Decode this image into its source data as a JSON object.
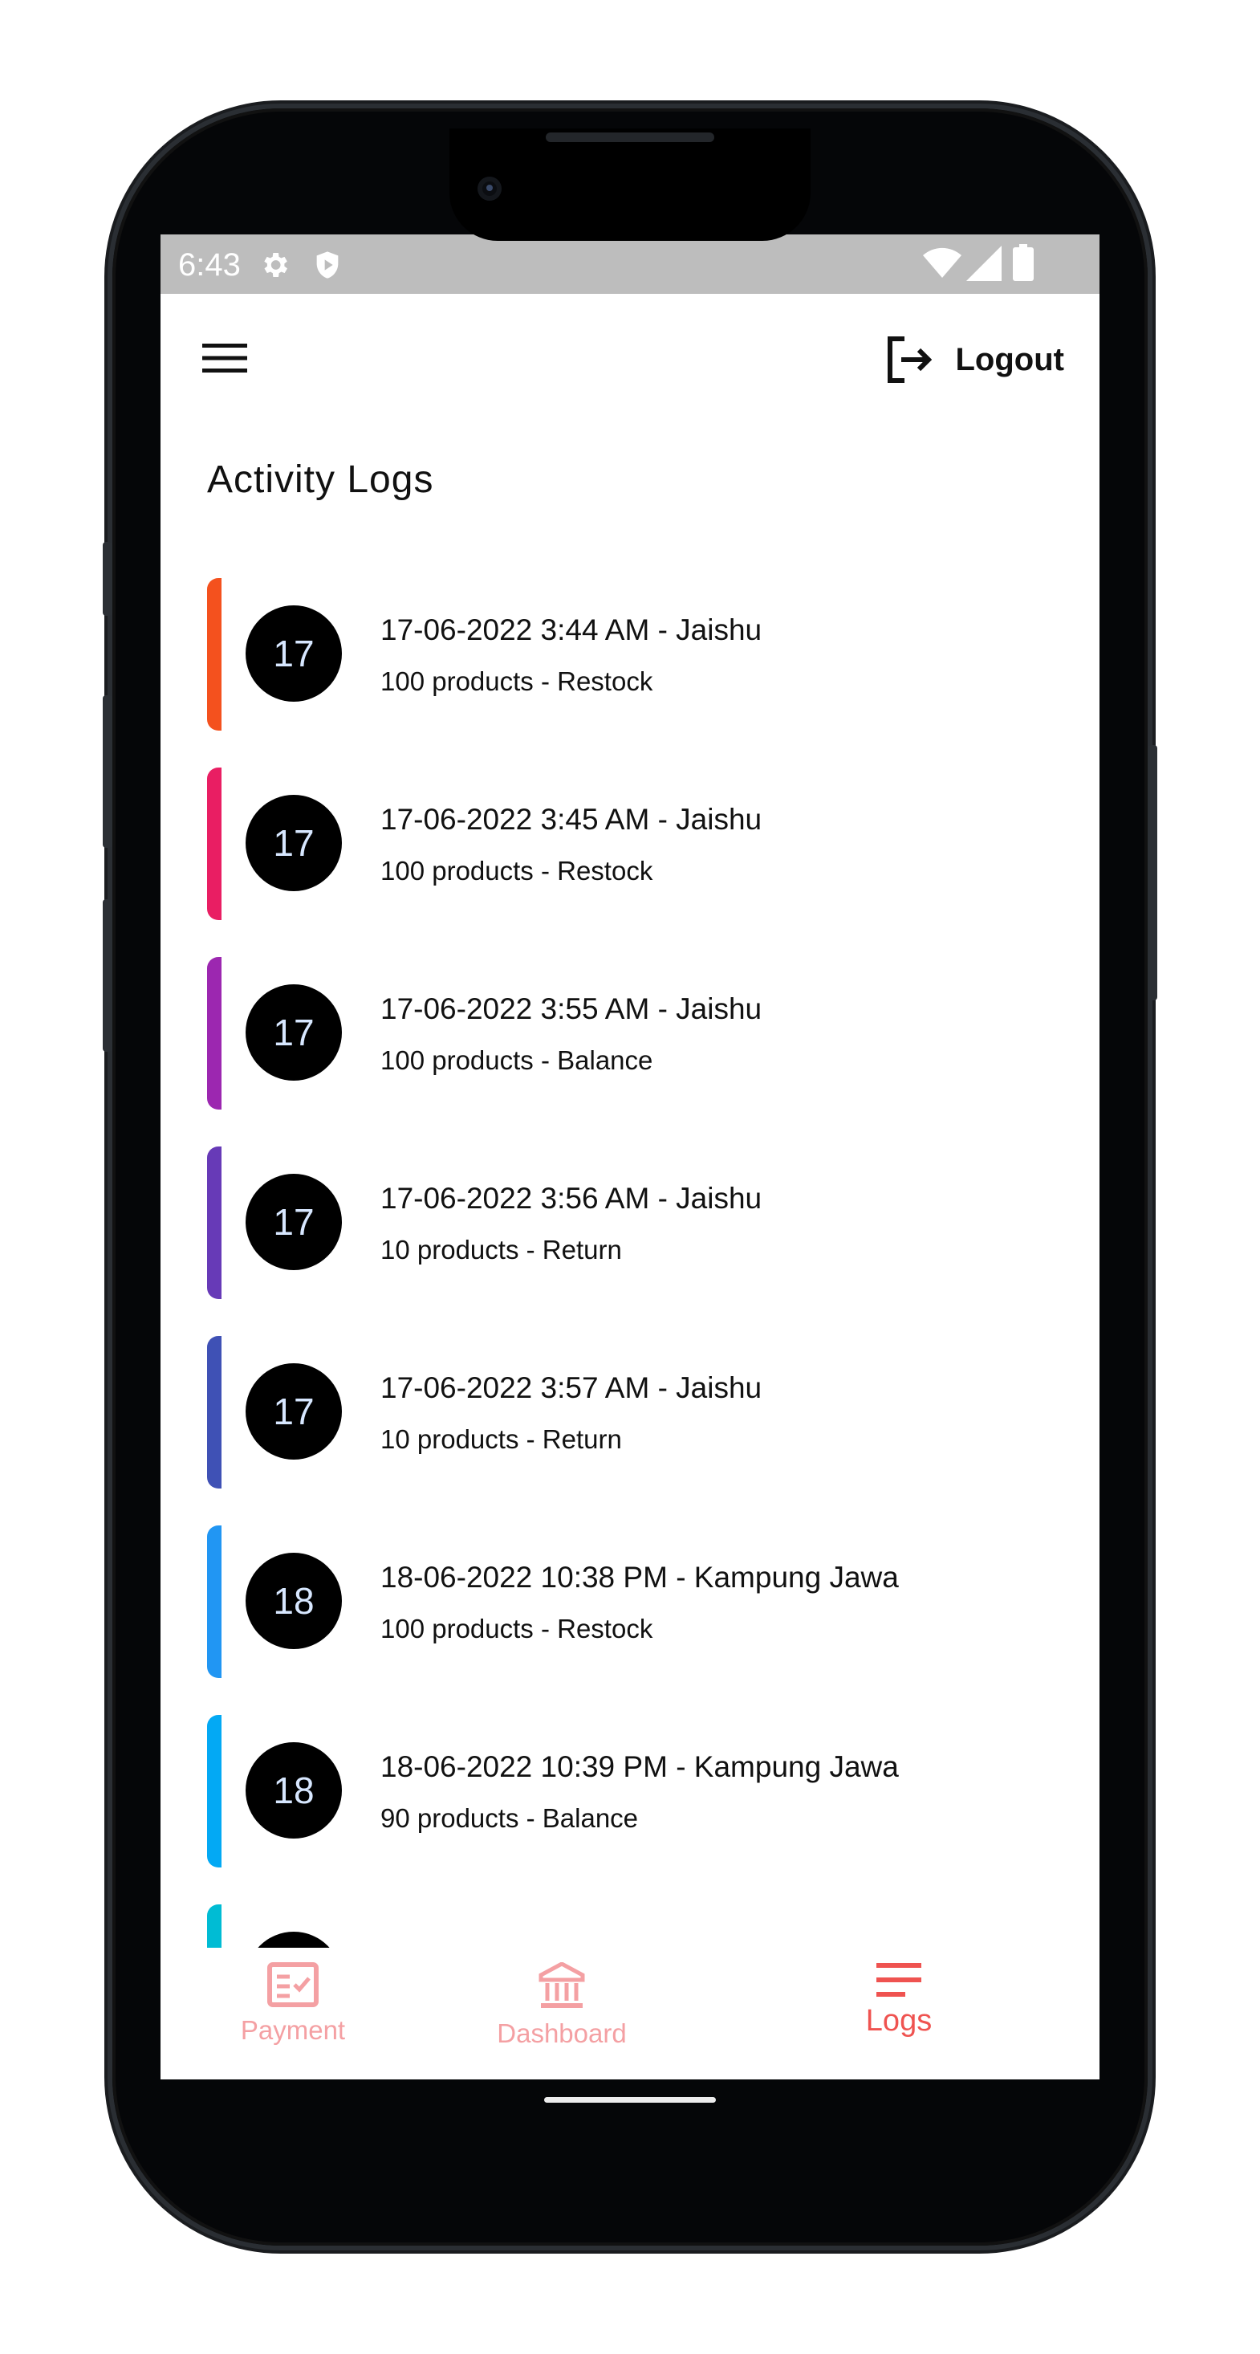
{
  "status_bar": {
    "time": "6:43",
    "icons": [
      "settings-icon",
      "shield-icon",
      "wifi-icon",
      "signal-icon",
      "battery-icon"
    ]
  },
  "app_bar": {
    "menu_icon": "hamburger-menu-icon",
    "logout_label": "Logout",
    "logout_icon": "logout-icon"
  },
  "page": {
    "title": "Activity Logs"
  },
  "logs": [
    {
      "day": "17",
      "title": "17-06-2022 3:44 AM - Jaishu",
      "sub": "100 products - Restock",
      "color": "#f4511e"
    },
    {
      "day": "17",
      "title": "17-06-2022 3:45 AM - Jaishu",
      "sub": "100 products - Restock",
      "color": "#e91e63"
    },
    {
      "day": "17",
      "title": "17-06-2022 3:55 AM - Jaishu",
      "sub": "100 products - Balance",
      "color": "#9c27b0"
    },
    {
      "day": "17",
      "title": "17-06-2022 3:56 AM - Jaishu",
      "sub": "10 products - Return",
      "color": "#673ab7"
    },
    {
      "day": "17",
      "title": "17-06-2022 3:57 AM - Jaishu",
      "sub": "10 products - Return",
      "color": "#3f51b5"
    },
    {
      "day": "18",
      "title": "18-06-2022 10:38 PM - Kampung Jawa",
      "sub": "100 products - Restock",
      "color": "#2196f3"
    },
    {
      "day": "18",
      "title": "18-06-2022 10:39 PM - Kampung Jawa",
      "sub": "90 products - Balance",
      "color": "#03a9f4"
    },
    {
      "day": "",
      "title": "",
      "sub": "",
      "color": "#00bcd4"
    }
  ],
  "bottom_nav": {
    "items": [
      {
        "label": "Payment",
        "icon": "payment-icon",
        "active": false
      },
      {
        "label": "Dashboard",
        "icon": "bank-icon",
        "active": false
      },
      {
        "label": "Logs",
        "icon": "list-icon",
        "active": true
      }
    ],
    "active_color": "#ef5350",
    "inactive_color": "#f4a0a3"
  }
}
